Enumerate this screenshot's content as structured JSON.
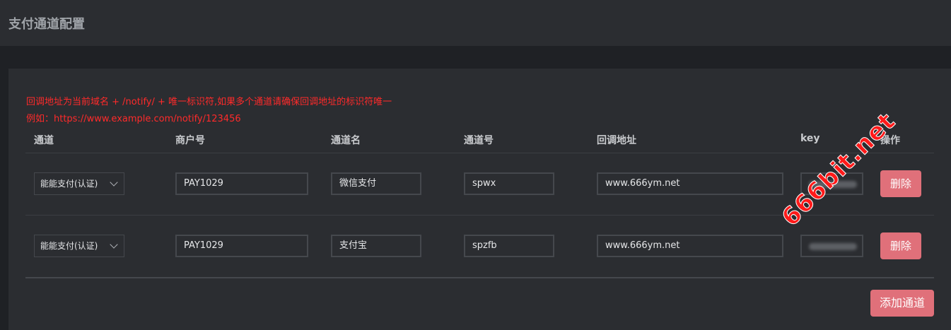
{
  "page_title": "支付通道配置",
  "notice": {
    "line1": "回调地址为当前域名 + /notify/ + 唯一标识符,如果多个通道请确保回调地址的标识符唯一",
    "line2": "例如：https://www.example.com/notify/123456"
  },
  "columns": [
    "通道",
    "商户号",
    "通道名",
    "通道号",
    "回调地址",
    "key",
    "操作"
  ],
  "rows": [
    {
      "channel": "能能支付(认证)",
      "merchant_id": "PAY1029",
      "channel_name": "微信支付",
      "channel_no": "spwx",
      "callback": "www.666ym.net",
      "delete_label": "删除"
    },
    {
      "channel": "能能支付(认证)",
      "merchant_id": "PAY1029",
      "channel_name": "支付宝",
      "channel_no": "spzfb",
      "callback": "www.666ym.net",
      "delete_label": "删除"
    }
  ],
  "add_button": "添加通道",
  "watermark": "666bit.net",
  "colors": {
    "accent": "#e0707a",
    "notice": "#ff2a2a",
    "background": "#2b2d31"
  }
}
